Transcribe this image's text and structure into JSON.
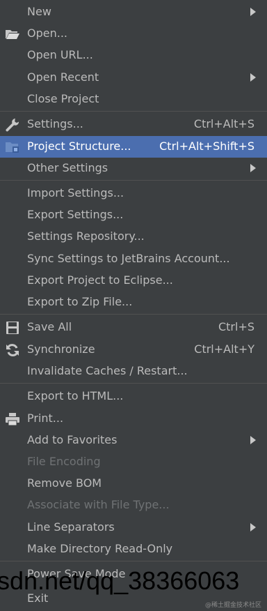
{
  "menu": {
    "items": [
      {
        "label": "New",
        "shortcut": "",
        "submenu": true,
        "disabled": false,
        "selected": false
      },
      {
        "label": "Open...",
        "shortcut": "",
        "submenu": false,
        "disabled": false,
        "selected": false,
        "icon": "folder-open-icon"
      },
      {
        "label": "Open URL...",
        "shortcut": "",
        "submenu": false,
        "disabled": false,
        "selected": false
      },
      {
        "label": "Open Recent",
        "shortcut": "",
        "submenu": true,
        "disabled": false,
        "selected": false
      },
      {
        "label": "Close Project",
        "shortcut": "",
        "submenu": false,
        "disabled": false,
        "selected": false
      },
      {
        "label": "Settings...",
        "shortcut": "Ctrl+Alt+S",
        "submenu": false,
        "disabled": false,
        "selected": false,
        "icon": "wrench-icon"
      },
      {
        "label": "Project Structure...",
        "shortcut": "Ctrl+Alt+Shift+S",
        "submenu": false,
        "disabled": false,
        "selected": true,
        "icon": "project-structure-icon"
      },
      {
        "label": "Other Settings",
        "shortcut": "",
        "submenu": true,
        "disabled": false,
        "selected": false
      },
      {
        "label": "Import Settings...",
        "shortcut": "",
        "submenu": false,
        "disabled": false,
        "selected": false
      },
      {
        "label": "Export Settings...",
        "shortcut": "",
        "submenu": false,
        "disabled": false,
        "selected": false
      },
      {
        "label": "Settings Repository...",
        "shortcut": "",
        "submenu": false,
        "disabled": false,
        "selected": false
      },
      {
        "label": "Sync Settings to JetBrains Account...",
        "shortcut": "",
        "submenu": false,
        "disabled": false,
        "selected": false
      },
      {
        "label": "Export Project to Eclipse...",
        "shortcut": "",
        "submenu": false,
        "disabled": false,
        "selected": false
      },
      {
        "label": "Export to Zip File...",
        "shortcut": "",
        "submenu": false,
        "disabled": false,
        "selected": false
      },
      {
        "label": "Save All",
        "shortcut": "Ctrl+S",
        "submenu": false,
        "disabled": false,
        "selected": false,
        "icon": "save-icon"
      },
      {
        "label": "Synchronize",
        "shortcut": "Ctrl+Alt+Y",
        "submenu": false,
        "disabled": false,
        "selected": false,
        "icon": "sync-icon"
      },
      {
        "label": "Invalidate Caches / Restart...",
        "shortcut": "",
        "submenu": false,
        "disabled": false,
        "selected": false
      },
      {
        "label": "Export to HTML...",
        "shortcut": "",
        "submenu": false,
        "disabled": false,
        "selected": false
      },
      {
        "label": "Print...",
        "shortcut": "",
        "submenu": false,
        "disabled": false,
        "selected": false,
        "icon": "printer-icon"
      },
      {
        "label": "Add to Favorites",
        "shortcut": "",
        "submenu": true,
        "disabled": false,
        "selected": false
      },
      {
        "label": "File Encoding",
        "shortcut": "",
        "submenu": false,
        "disabled": true,
        "selected": false
      },
      {
        "label": "Remove BOM",
        "shortcut": "",
        "submenu": false,
        "disabled": false,
        "selected": false
      },
      {
        "label": "Associate with File Type...",
        "shortcut": "",
        "submenu": false,
        "disabled": true,
        "selected": false
      },
      {
        "label": "Line Separators",
        "shortcut": "",
        "submenu": true,
        "disabled": false,
        "selected": false
      },
      {
        "label": "Make Directory Read-Only",
        "shortcut": "",
        "submenu": false,
        "disabled": false,
        "selected": false
      },
      {
        "label": "Power Save Mode",
        "shortcut": "",
        "submenu": false,
        "disabled": false,
        "selected": false
      },
      {
        "label": "Exit",
        "shortcut": "",
        "submenu": false,
        "disabled": false,
        "selected": false
      }
    ]
  },
  "watermark": {
    "text": "sdn.net/qq_38366063",
    "small": "@稀土掘金技术社区"
  },
  "colors": {
    "background": "#3c3f41",
    "selection": "#4b6eaf",
    "text": "#bbbbbb",
    "disabled_text": "#6f7274",
    "separator": "#515151"
  }
}
